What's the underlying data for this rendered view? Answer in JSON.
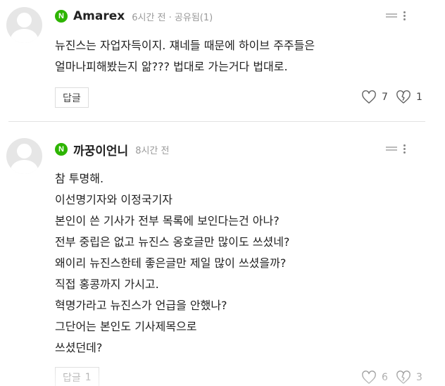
{
  "comments": [
    {
      "badge": "N",
      "author": "Amarex",
      "time": "6시간 전 · 공유됨(1)",
      "lines": [
        "뉴진스는 자업자득이지. 쟤네들 때문에 하이브 주주들은",
        "얼마나피해봤는지 앎??? 법대로 가는거다 법대로."
      ],
      "reply_label": "답글",
      "reply_count": "",
      "likes": "7",
      "dislikes": "1"
    },
    {
      "badge": "N",
      "author": "까꿍이언니",
      "time": "8시간 전",
      "lines": [
        "참 투명해.",
        "이선명기자와 이정국기자",
        "본인이 쓴 기사가 전부 목록에 보인다는건 아나?",
        "전부 중립은 없고 뉴진스 옹호글만 많이도 쓰셨네?",
        "왜이리 뉴진스한테 좋은글만 제일 많이 쓰셨을까?",
        "직접 홍콩까지 가시고.",
        "혁명가라고 뉴진스가 언급을 안했나?",
        "그단어는 본인도 기사제목으로",
        "쓰셨던데?"
      ],
      "reply_label": "답글",
      "reply_count": "1",
      "likes": "6",
      "dislikes": "3"
    }
  ]
}
